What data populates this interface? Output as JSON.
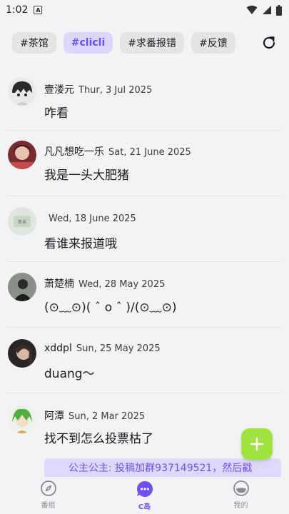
{
  "status_bar": {
    "time": "1:02",
    "badge": "A"
  },
  "tags": [
    {
      "label": "#茶馆",
      "active": false
    },
    {
      "label": "#clicli",
      "active": true
    },
    {
      "label": "#求番报错",
      "active": false
    },
    {
      "label": "#反馈",
      "active": false
    }
  ],
  "posts": [
    {
      "author": "壹溇元",
      "date": "Thur, 3 Jul 2025",
      "content": "咋看"
    },
    {
      "author": "凡凡想吃一乐",
      "date": "Sat, 21 June 2025",
      "content": "我是一头大肥猪"
    },
    {
      "author": "",
      "date": "Wed, 18 June 2025",
      "content": "看谁来报道哦"
    },
    {
      "author": "萧楚楠",
      "date": "Wed, 28 May 2025",
      "content": "(⊙﹏⊙)( ˆ o ˆ )/(⊙﹏⊙)"
    },
    {
      "author": "xddpl",
      "date": "Sun, 25 May 2025",
      "content": "duang～"
    },
    {
      "author": "阿潭",
      "date": "Sun, 2 Mar 2025",
      "content": "找不到怎么投票枯了"
    }
  ],
  "notice": "公主公主: 投稿加群937149521，然后戳",
  "bottom_nav": [
    {
      "label": "番组",
      "icon": "compass-icon",
      "active": false
    },
    {
      "label": "C岛",
      "icon": "chat-bubble-icon",
      "active": true
    },
    {
      "label": "我的",
      "icon": "face-icon",
      "active": false
    }
  ],
  "colors": {
    "accent": "#6f4ef2",
    "fab": "#9ee33f",
    "tag_bg": "#e4e3e6",
    "tag_active_bg": "#dcd6fb"
  }
}
